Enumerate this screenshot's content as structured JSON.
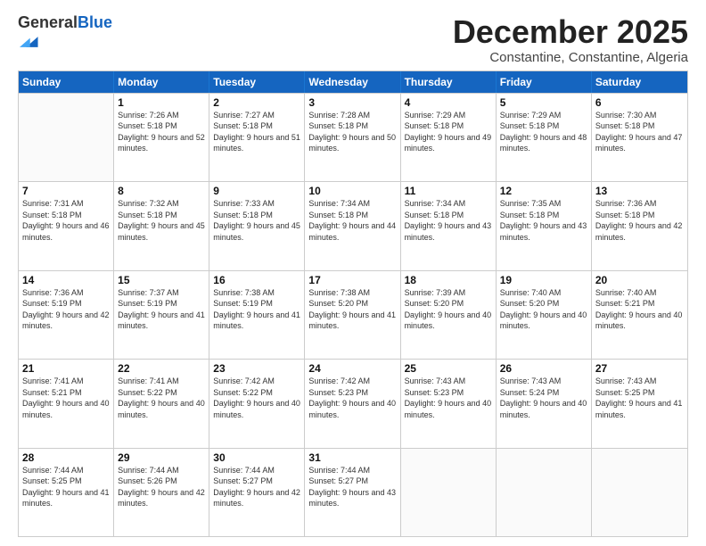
{
  "logo": {
    "general": "General",
    "blue": "Blue"
  },
  "title": "December 2025",
  "subtitle": "Constantine, Constantine, Algeria",
  "header_days": [
    "Sunday",
    "Monday",
    "Tuesday",
    "Wednesday",
    "Thursday",
    "Friday",
    "Saturday"
  ],
  "weeks": [
    [
      {
        "day": "",
        "sunrise": "",
        "sunset": "",
        "daylight": ""
      },
      {
        "day": "1",
        "sunrise": "Sunrise: 7:26 AM",
        "sunset": "Sunset: 5:18 PM",
        "daylight": "Daylight: 9 hours and 52 minutes."
      },
      {
        "day": "2",
        "sunrise": "Sunrise: 7:27 AM",
        "sunset": "Sunset: 5:18 PM",
        "daylight": "Daylight: 9 hours and 51 minutes."
      },
      {
        "day": "3",
        "sunrise": "Sunrise: 7:28 AM",
        "sunset": "Sunset: 5:18 PM",
        "daylight": "Daylight: 9 hours and 50 minutes."
      },
      {
        "day": "4",
        "sunrise": "Sunrise: 7:29 AM",
        "sunset": "Sunset: 5:18 PM",
        "daylight": "Daylight: 9 hours and 49 minutes."
      },
      {
        "day": "5",
        "sunrise": "Sunrise: 7:29 AM",
        "sunset": "Sunset: 5:18 PM",
        "daylight": "Daylight: 9 hours and 48 minutes."
      },
      {
        "day": "6",
        "sunrise": "Sunrise: 7:30 AM",
        "sunset": "Sunset: 5:18 PM",
        "daylight": "Daylight: 9 hours and 47 minutes."
      }
    ],
    [
      {
        "day": "7",
        "sunrise": "Sunrise: 7:31 AM",
        "sunset": "Sunset: 5:18 PM",
        "daylight": "Daylight: 9 hours and 46 minutes."
      },
      {
        "day": "8",
        "sunrise": "Sunrise: 7:32 AM",
        "sunset": "Sunset: 5:18 PM",
        "daylight": "Daylight: 9 hours and 45 minutes."
      },
      {
        "day": "9",
        "sunrise": "Sunrise: 7:33 AM",
        "sunset": "Sunset: 5:18 PM",
        "daylight": "Daylight: 9 hours and 45 minutes."
      },
      {
        "day": "10",
        "sunrise": "Sunrise: 7:34 AM",
        "sunset": "Sunset: 5:18 PM",
        "daylight": "Daylight: 9 hours and 44 minutes."
      },
      {
        "day": "11",
        "sunrise": "Sunrise: 7:34 AM",
        "sunset": "Sunset: 5:18 PM",
        "daylight": "Daylight: 9 hours and 43 minutes."
      },
      {
        "day": "12",
        "sunrise": "Sunrise: 7:35 AM",
        "sunset": "Sunset: 5:18 PM",
        "daylight": "Daylight: 9 hours and 43 minutes."
      },
      {
        "day": "13",
        "sunrise": "Sunrise: 7:36 AM",
        "sunset": "Sunset: 5:18 PM",
        "daylight": "Daylight: 9 hours and 42 minutes."
      }
    ],
    [
      {
        "day": "14",
        "sunrise": "Sunrise: 7:36 AM",
        "sunset": "Sunset: 5:19 PM",
        "daylight": "Daylight: 9 hours and 42 minutes."
      },
      {
        "day": "15",
        "sunrise": "Sunrise: 7:37 AM",
        "sunset": "Sunset: 5:19 PM",
        "daylight": "Daylight: 9 hours and 41 minutes."
      },
      {
        "day": "16",
        "sunrise": "Sunrise: 7:38 AM",
        "sunset": "Sunset: 5:19 PM",
        "daylight": "Daylight: 9 hours and 41 minutes."
      },
      {
        "day": "17",
        "sunrise": "Sunrise: 7:38 AM",
        "sunset": "Sunset: 5:20 PM",
        "daylight": "Daylight: 9 hours and 41 minutes."
      },
      {
        "day": "18",
        "sunrise": "Sunrise: 7:39 AM",
        "sunset": "Sunset: 5:20 PM",
        "daylight": "Daylight: 9 hours and 40 minutes."
      },
      {
        "day": "19",
        "sunrise": "Sunrise: 7:40 AM",
        "sunset": "Sunset: 5:20 PM",
        "daylight": "Daylight: 9 hours and 40 minutes."
      },
      {
        "day": "20",
        "sunrise": "Sunrise: 7:40 AM",
        "sunset": "Sunset: 5:21 PM",
        "daylight": "Daylight: 9 hours and 40 minutes."
      }
    ],
    [
      {
        "day": "21",
        "sunrise": "Sunrise: 7:41 AM",
        "sunset": "Sunset: 5:21 PM",
        "daylight": "Daylight: 9 hours and 40 minutes."
      },
      {
        "day": "22",
        "sunrise": "Sunrise: 7:41 AM",
        "sunset": "Sunset: 5:22 PM",
        "daylight": "Daylight: 9 hours and 40 minutes."
      },
      {
        "day": "23",
        "sunrise": "Sunrise: 7:42 AM",
        "sunset": "Sunset: 5:22 PM",
        "daylight": "Daylight: 9 hours and 40 minutes."
      },
      {
        "day": "24",
        "sunrise": "Sunrise: 7:42 AM",
        "sunset": "Sunset: 5:23 PM",
        "daylight": "Daylight: 9 hours and 40 minutes."
      },
      {
        "day": "25",
        "sunrise": "Sunrise: 7:43 AM",
        "sunset": "Sunset: 5:23 PM",
        "daylight": "Daylight: 9 hours and 40 minutes."
      },
      {
        "day": "26",
        "sunrise": "Sunrise: 7:43 AM",
        "sunset": "Sunset: 5:24 PM",
        "daylight": "Daylight: 9 hours and 40 minutes."
      },
      {
        "day": "27",
        "sunrise": "Sunrise: 7:43 AM",
        "sunset": "Sunset: 5:25 PM",
        "daylight": "Daylight: 9 hours and 41 minutes."
      }
    ],
    [
      {
        "day": "28",
        "sunrise": "Sunrise: 7:44 AM",
        "sunset": "Sunset: 5:25 PM",
        "daylight": "Daylight: 9 hours and 41 minutes."
      },
      {
        "day": "29",
        "sunrise": "Sunrise: 7:44 AM",
        "sunset": "Sunset: 5:26 PM",
        "daylight": "Daylight: 9 hours and 42 minutes."
      },
      {
        "day": "30",
        "sunrise": "Sunrise: 7:44 AM",
        "sunset": "Sunset: 5:27 PM",
        "daylight": "Daylight: 9 hours and 42 minutes."
      },
      {
        "day": "31",
        "sunrise": "Sunrise: 7:44 AM",
        "sunset": "Sunset: 5:27 PM",
        "daylight": "Daylight: 9 hours and 43 minutes."
      },
      {
        "day": "",
        "sunrise": "",
        "sunset": "",
        "daylight": ""
      },
      {
        "day": "",
        "sunrise": "",
        "sunset": "",
        "daylight": ""
      },
      {
        "day": "",
        "sunrise": "",
        "sunset": "",
        "daylight": ""
      }
    ]
  ]
}
